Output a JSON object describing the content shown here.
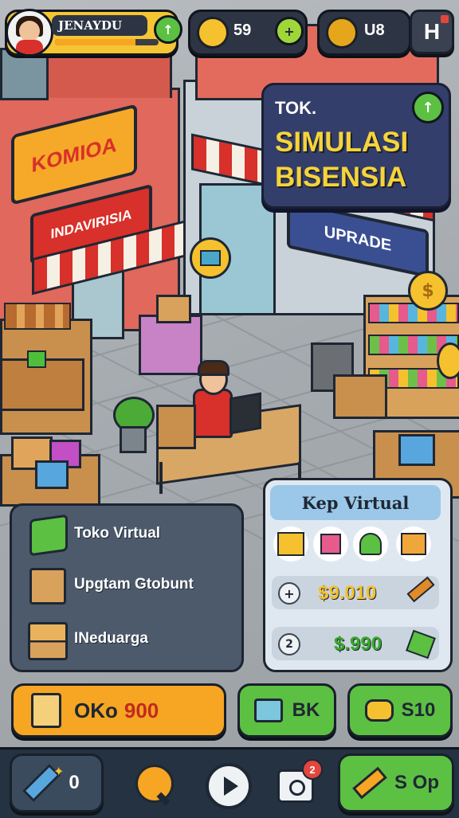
{
  "hud": {
    "player_name": "JENAYDU",
    "coins_value": "59",
    "gems_value": "U8",
    "level_icon": "arrow-up-icon",
    "menu_label": "H"
  },
  "banner": {
    "small": "TOK.",
    "line1": "SIMULASI",
    "line2": "BISENSIA"
  },
  "signs": {
    "shop_left_top": "KOMIOA",
    "shop_left_awning": "INDAVIRISIA",
    "shop_right": "UPRADE"
  },
  "left_panel": {
    "items": [
      {
        "label": "Toko Virtual",
        "icon": "green-box-icon"
      },
      {
        "label": "Upgtam Gtobunt",
        "icon": "parcel-icon"
      },
      {
        "label": "INeduarga",
        "icon": "stacked-boxes-icon"
      }
    ]
  },
  "right_panel": {
    "title": "Kep Virtual",
    "row1_value": "$9.010",
    "row2_value": "$.990",
    "row1_icon": "plus-icon",
    "row2_icon": "refresh-icon"
  },
  "action_bar": {
    "order_label": "OKo",
    "order_value": "900",
    "bk_label": "BK",
    "s10_label": "S10"
  },
  "bottom_nav": {
    "tools_count": "0",
    "camera_badge": "2",
    "shop_label": "S Op"
  },
  "colors": {
    "panel_slate": "#4c5a6c",
    "panel_light": "#d9e6f2",
    "orange": "#f6a623",
    "green": "#5cc043",
    "gold": "#f5c12e",
    "money_green": "#38a82a"
  }
}
